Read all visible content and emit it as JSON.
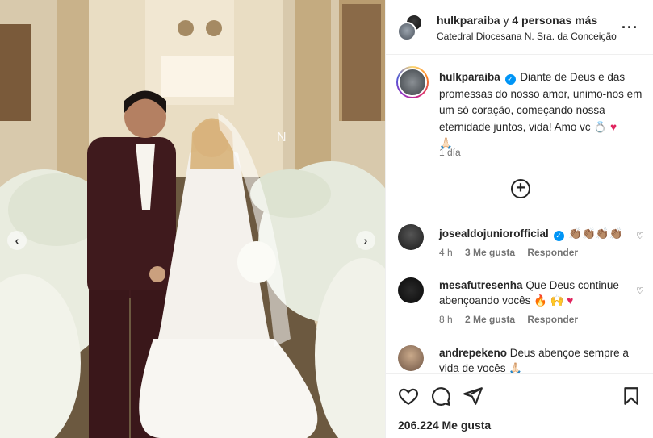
{
  "post": {
    "header_user": "hulkparaiba",
    "header_conj": " y ",
    "header_others": "4 personas más",
    "location": "Catedral Diocesana N. Sra. da Conceição",
    "more_icon": "···"
  },
  "caption": {
    "username": "hulkparaiba",
    "text": "Diante de Deus e das promessas do nosso amor, unimo-nos em um só coração, começando nossa eternidade juntos, vida! Amo vc",
    "emoji_ring": "💍",
    "emoji_heart": "♥",
    "emoji_pray": "🙏🏻",
    "time": "1 día"
  },
  "add_comment_icon": "+",
  "comments": [
    {
      "username": "josealdojuniorofficial",
      "verified": true,
      "text": "👏🏽👏🏽👏🏽👏🏽",
      "time": "4 h",
      "likes": "3 Me gusta",
      "reply": "Responder"
    },
    {
      "username": "mesafutresenha",
      "verified": false,
      "text": "Que Deus continue abençoando vocês",
      "emojis": "🔥 🙌 ♥",
      "time": "8 h",
      "likes": "2 Me gusta",
      "reply": "Responder"
    },
    {
      "username": "andrepekeno",
      "verified": false,
      "text": "Deus abençoe sempre a vida de vocês",
      "emojis": "🙏🏻"
    }
  ],
  "likes_count": "206.224 Me gusta",
  "colors": {
    "accent_blue": "#0095f6",
    "heart_red": "#e0245e",
    "muted": "#737373",
    "border": "#efefef"
  },
  "icons": [
    "like-heart-icon",
    "comment-icon",
    "share-icon",
    "save-bookmark-icon",
    "verified-badge-icon",
    "nav-left-icon",
    "nav-right-icon"
  ]
}
